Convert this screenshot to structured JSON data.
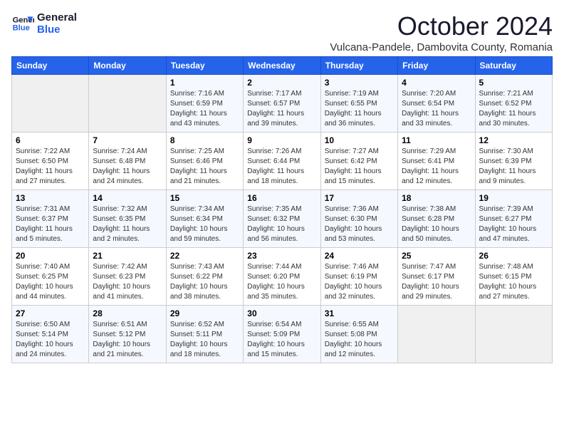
{
  "logo": {
    "line1": "General",
    "line2": "Blue"
  },
  "title": "October 2024",
  "subtitle": "Vulcana-Pandele, Dambovita County, Romania",
  "days_header": [
    "Sunday",
    "Monday",
    "Tuesday",
    "Wednesday",
    "Thursday",
    "Friday",
    "Saturday"
  ],
  "weeks": [
    [
      {
        "num": "",
        "info": ""
      },
      {
        "num": "",
        "info": ""
      },
      {
        "num": "1",
        "info": "Sunrise: 7:16 AM\nSunset: 6:59 PM\nDaylight: 11 hours and 43 minutes."
      },
      {
        "num": "2",
        "info": "Sunrise: 7:17 AM\nSunset: 6:57 PM\nDaylight: 11 hours and 39 minutes."
      },
      {
        "num": "3",
        "info": "Sunrise: 7:19 AM\nSunset: 6:55 PM\nDaylight: 11 hours and 36 minutes."
      },
      {
        "num": "4",
        "info": "Sunrise: 7:20 AM\nSunset: 6:54 PM\nDaylight: 11 hours and 33 minutes."
      },
      {
        "num": "5",
        "info": "Sunrise: 7:21 AM\nSunset: 6:52 PM\nDaylight: 11 hours and 30 minutes."
      }
    ],
    [
      {
        "num": "6",
        "info": "Sunrise: 7:22 AM\nSunset: 6:50 PM\nDaylight: 11 hours and 27 minutes."
      },
      {
        "num": "7",
        "info": "Sunrise: 7:24 AM\nSunset: 6:48 PM\nDaylight: 11 hours and 24 minutes."
      },
      {
        "num": "8",
        "info": "Sunrise: 7:25 AM\nSunset: 6:46 PM\nDaylight: 11 hours and 21 minutes."
      },
      {
        "num": "9",
        "info": "Sunrise: 7:26 AM\nSunset: 6:44 PM\nDaylight: 11 hours and 18 minutes."
      },
      {
        "num": "10",
        "info": "Sunrise: 7:27 AM\nSunset: 6:42 PM\nDaylight: 11 hours and 15 minutes."
      },
      {
        "num": "11",
        "info": "Sunrise: 7:29 AM\nSunset: 6:41 PM\nDaylight: 11 hours and 12 minutes."
      },
      {
        "num": "12",
        "info": "Sunrise: 7:30 AM\nSunset: 6:39 PM\nDaylight: 11 hours and 9 minutes."
      }
    ],
    [
      {
        "num": "13",
        "info": "Sunrise: 7:31 AM\nSunset: 6:37 PM\nDaylight: 11 hours and 5 minutes."
      },
      {
        "num": "14",
        "info": "Sunrise: 7:32 AM\nSunset: 6:35 PM\nDaylight: 11 hours and 2 minutes."
      },
      {
        "num": "15",
        "info": "Sunrise: 7:34 AM\nSunset: 6:34 PM\nDaylight: 10 hours and 59 minutes."
      },
      {
        "num": "16",
        "info": "Sunrise: 7:35 AM\nSunset: 6:32 PM\nDaylight: 10 hours and 56 minutes."
      },
      {
        "num": "17",
        "info": "Sunrise: 7:36 AM\nSunset: 6:30 PM\nDaylight: 10 hours and 53 minutes."
      },
      {
        "num": "18",
        "info": "Sunrise: 7:38 AM\nSunset: 6:28 PM\nDaylight: 10 hours and 50 minutes."
      },
      {
        "num": "19",
        "info": "Sunrise: 7:39 AM\nSunset: 6:27 PM\nDaylight: 10 hours and 47 minutes."
      }
    ],
    [
      {
        "num": "20",
        "info": "Sunrise: 7:40 AM\nSunset: 6:25 PM\nDaylight: 10 hours and 44 minutes."
      },
      {
        "num": "21",
        "info": "Sunrise: 7:42 AM\nSunset: 6:23 PM\nDaylight: 10 hours and 41 minutes."
      },
      {
        "num": "22",
        "info": "Sunrise: 7:43 AM\nSunset: 6:22 PM\nDaylight: 10 hours and 38 minutes."
      },
      {
        "num": "23",
        "info": "Sunrise: 7:44 AM\nSunset: 6:20 PM\nDaylight: 10 hours and 35 minutes."
      },
      {
        "num": "24",
        "info": "Sunrise: 7:46 AM\nSunset: 6:19 PM\nDaylight: 10 hours and 32 minutes."
      },
      {
        "num": "25",
        "info": "Sunrise: 7:47 AM\nSunset: 6:17 PM\nDaylight: 10 hours and 29 minutes."
      },
      {
        "num": "26",
        "info": "Sunrise: 7:48 AM\nSunset: 6:15 PM\nDaylight: 10 hours and 27 minutes."
      }
    ],
    [
      {
        "num": "27",
        "info": "Sunrise: 6:50 AM\nSunset: 5:14 PM\nDaylight: 10 hours and 24 minutes."
      },
      {
        "num": "28",
        "info": "Sunrise: 6:51 AM\nSunset: 5:12 PM\nDaylight: 10 hours and 21 minutes."
      },
      {
        "num": "29",
        "info": "Sunrise: 6:52 AM\nSunset: 5:11 PM\nDaylight: 10 hours and 18 minutes."
      },
      {
        "num": "30",
        "info": "Sunrise: 6:54 AM\nSunset: 5:09 PM\nDaylight: 10 hours and 15 minutes."
      },
      {
        "num": "31",
        "info": "Sunrise: 6:55 AM\nSunset: 5:08 PM\nDaylight: 10 hours and 12 minutes."
      },
      {
        "num": "",
        "info": ""
      },
      {
        "num": "",
        "info": ""
      }
    ]
  ]
}
